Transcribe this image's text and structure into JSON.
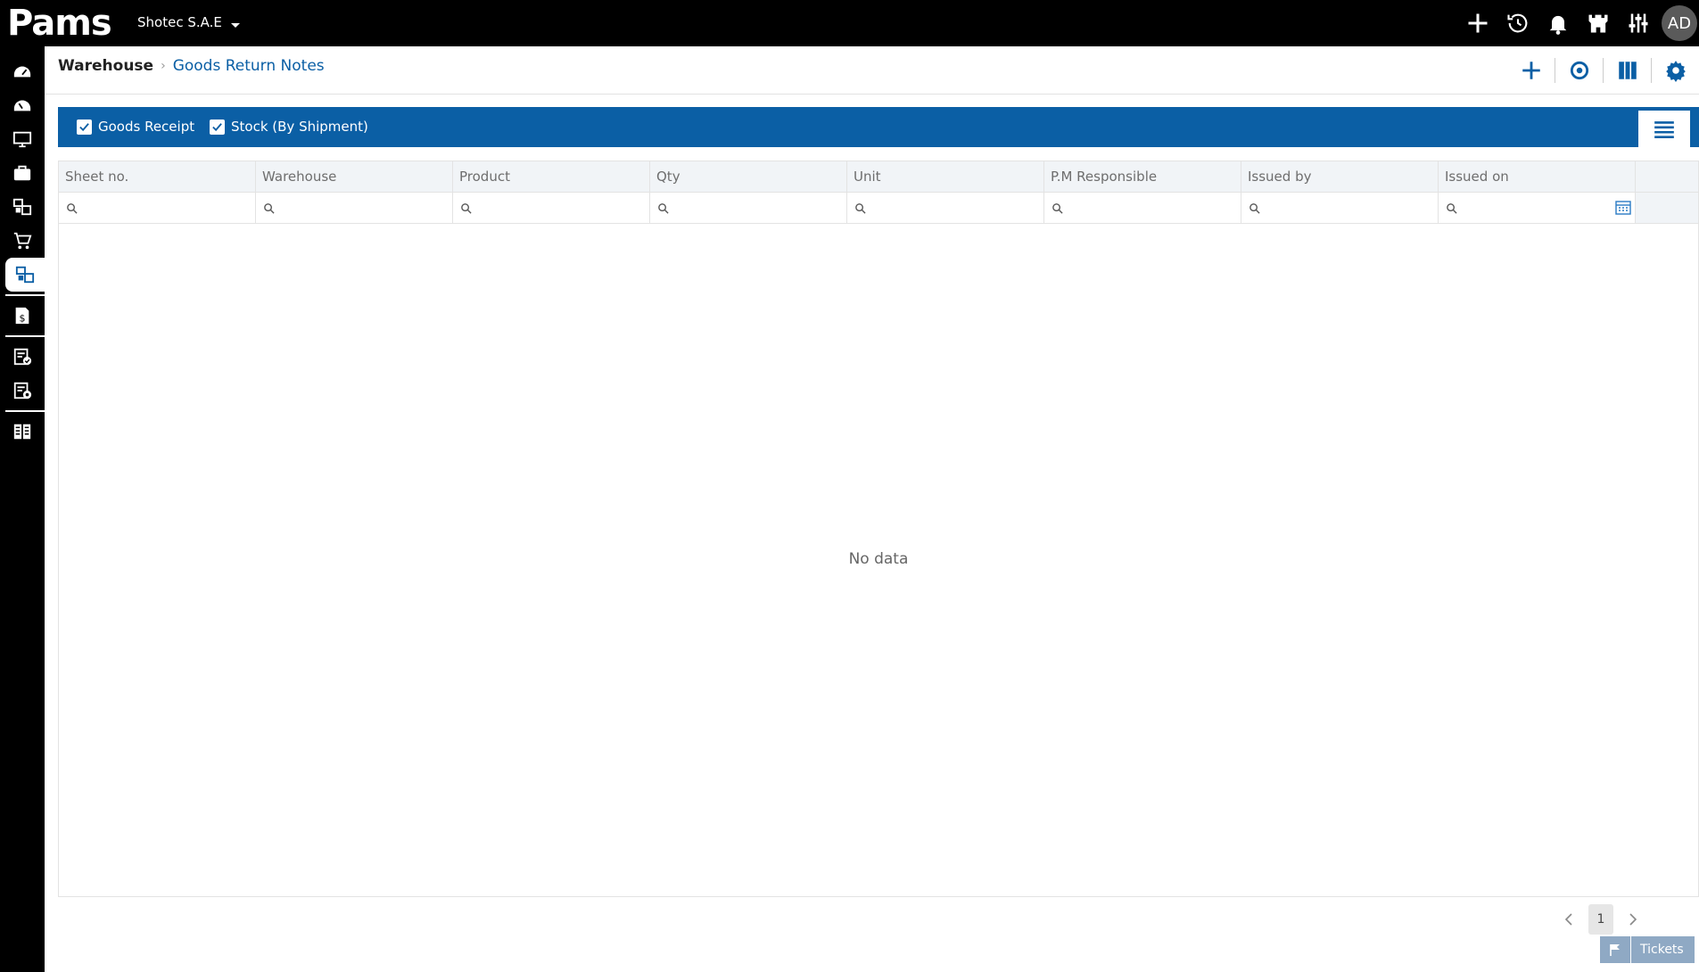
{
  "app": {
    "logo_text": "Pams",
    "company": "Shotec S.A.E"
  },
  "topbar": {
    "icons": [
      "plus-icon",
      "history-icon",
      "bell-icon",
      "castle-icon",
      "sliders-icon"
    ],
    "avatar_initials": "AD"
  },
  "sidebar": {
    "items": [
      "dashboard-icon",
      "dashboard-alt-icon",
      "monitor-icon",
      "briefcase-icon",
      "warehouse-icon",
      "cart-icon",
      "warehouse-active-icon",
      "finance-icon",
      "approval-icon",
      "settings-doc-icon",
      "reports-icon"
    ],
    "active_index": 6
  },
  "breadcrumb": {
    "root": "Warehouse",
    "current": "Goods Return Notes"
  },
  "filters": {
    "goods_receipt": {
      "label": "Goods Receipt",
      "checked": true
    },
    "stock_by_shipment": {
      "label": "Stock (By Shipment)",
      "checked": true
    }
  },
  "grid": {
    "columns": [
      "Sheet no.",
      "Warehouse",
      "Product",
      "Qty",
      "Unit",
      "P.M Responsible",
      "Issued by",
      "Issued on"
    ],
    "empty_text": "No data"
  },
  "pager": {
    "current_page": "1"
  },
  "tickets": {
    "label": "Tickets"
  },
  "colors": {
    "accent": "#0b5fa5",
    "topbar": "#000000",
    "header_bg": "#f1f4f7"
  }
}
